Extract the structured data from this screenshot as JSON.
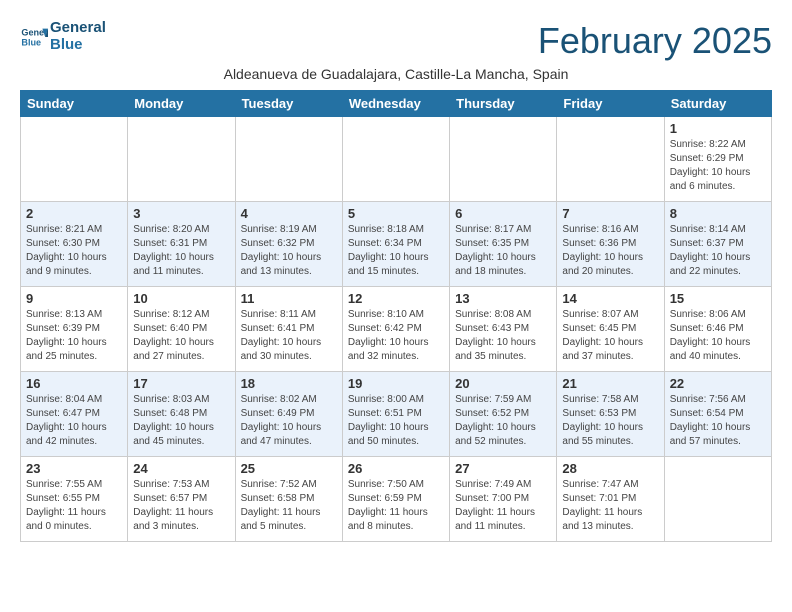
{
  "header": {
    "logo_line1": "General",
    "logo_line2": "Blue",
    "month_title": "February 2025",
    "subtitle": "Aldeanueva de Guadalajara, Castille-La Mancha, Spain"
  },
  "weekdays": [
    "Sunday",
    "Monday",
    "Tuesday",
    "Wednesday",
    "Thursday",
    "Friday",
    "Saturday"
  ],
  "weeks": [
    [
      {
        "day": "",
        "info": ""
      },
      {
        "day": "",
        "info": ""
      },
      {
        "day": "",
        "info": ""
      },
      {
        "day": "",
        "info": ""
      },
      {
        "day": "",
        "info": ""
      },
      {
        "day": "",
        "info": ""
      },
      {
        "day": "1",
        "info": "Sunrise: 8:22 AM\nSunset: 6:29 PM\nDaylight: 10 hours and 6 minutes."
      }
    ],
    [
      {
        "day": "2",
        "info": "Sunrise: 8:21 AM\nSunset: 6:30 PM\nDaylight: 10 hours and 9 minutes."
      },
      {
        "day": "3",
        "info": "Sunrise: 8:20 AM\nSunset: 6:31 PM\nDaylight: 10 hours and 11 minutes."
      },
      {
        "day": "4",
        "info": "Sunrise: 8:19 AM\nSunset: 6:32 PM\nDaylight: 10 hours and 13 minutes."
      },
      {
        "day": "5",
        "info": "Sunrise: 8:18 AM\nSunset: 6:34 PM\nDaylight: 10 hours and 15 minutes."
      },
      {
        "day": "6",
        "info": "Sunrise: 8:17 AM\nSunset: 6:35 PM\nDaylight: 10 hours and 18 minutes."
      },
      {
        "day": "7",
        "info": "Sunrise: 8:16 AM\nSunset: 6:36 PM\nDaylight: 10 hours and 20 minutes."
      },
      {
        "day": "8",
        "info": "Sunrise: 8:14 AM\nSunset: 6:37 PM\nDaylight: 10 hours and 22 minutes."
      }
    ],
    [
      {
        "day": "9",
        "info": "Sunrise: 8:13 AM\nSunset: 6:39 PM\nDaylight: 10 hours and 25 minutes."
      },
      {
        "day": "10",
        "info": "Sunrise: 8:12 AM\nSunset: 6:40 PM\nDaylight: 10 hours and 27 minutes."
      },
      {
        "day": "11",
        "info": "Sunrise: 8:11 AM\nSunset: 6:41 PM\nDaylight: 10 hours and 30 minutes."
      },
      {
        "day": "12",
        "info": "Sunrise: 8:10 AM\nSunset: 6:42 PM\nDaylight: 10 hours and 32 minutes."
      },
      {
        "day": "13",
        "info": "Sunrise: 8:08 AM\nSunset: 6:43 PM\nDaylight: 10 hours and 35 minutes."
      },
      {
        "day": "14",
        "info": "Sunrise: 8:07 AM\nSunset: 6:45 PM\nDaylight: 10 hours and 37 minutes."
      },
      {
        "day": "15",
        "info": "Sunrise: 8:06 AM\nSunset: 6:46 PM\nDaylight: 10 hours and 40 minutes."
      }
    ],
    [
      {
        "day": "16",
        "info": "Sunrise: 8:04 AM\nSunset: 6:47 PM\nDaylight: 10 hours and 42 minutes."
      },
      {
        "day": "17",
        "info": "Sunrise: 8:03 AM\nSunset: 6:48 PM\nDaylight: 10 hours and 45 minutes."
      },
      {
        "day": "18",
        "info": "Sunrise: 8:02 AM\nSunset: 6:49 PM\nDaylight: 10 hours and 47 minutes."
      },
      {
        "day": "19",
        "info": "Sunrise: 8:00 AM\nSunset: 6:51 PM\nDaylight: 10 hours and 50 minutes."
      },
      {
        "day": "20",
        "info": "Sunrise: 7:59 AM\nSunset: 6:52 PM\nDaylight: 10 hours and 52 minutes."
      },
      {
        "day": "21",
        "info": "Sunrise: 7:58 AM\nSunset: 6:53 PM\nDaylight: 10 hours and 55 minutes."
      },
      {
        "day": "22",
        "info": "Sunrise: 7:56 AM\nSunset: 6:54 PM\nDaylight: 10 hours and 57 minutes."
      }
    ],
    [
      {
        "day": "23",
        "info": "Sunrise: 7:55 AM\nSunset: 6:55 PM\nDaylight: 11 hours and 0 minutes."
      },
      {
        "day": "24",
        "info": "Sunrise: 7:53 AM\nSunset: 6:57 PM\nDaylight: 11 hours and 3 minutes."
      },
      {
        "day": "25",
        "info": "Sunrise: 7:52 AM\nSunset: 6:58 PM\nDaylight: 11 hours and 5 minutes."
      },
      {
        "day": "26",
        "info": "Sunrise: 7:50 AM\nSunset: 6:59 PM\nDaylight: 11 hours and 8 minutes."
      },
      {
        "day": "27",
        "info": "Sunrise: 7:49 AM\nSunset: 7:00 PM\nDaylight: 11 hours and 11 minutes."
      },
      {
        "day": "28",
        "info": "Sunrise: 7:47 AM\nSunset: 7:01 PM\nDaylight: 11 hours and 13 minutes."
      },
      {
        "day": "",
        "info": ""
      }
    ]
  ]
}
